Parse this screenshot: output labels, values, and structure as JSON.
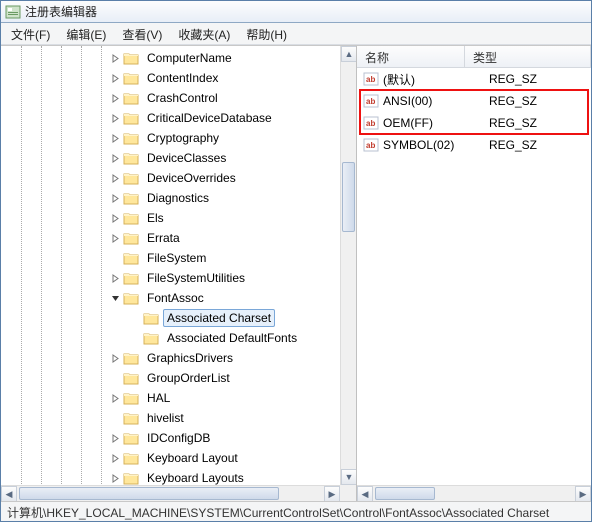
{
  "window": {
    "title": "注册表编辑器"
  },
  "menus": [
    {
      "label": "文件(F)"
    },
    {
      "label": "编辑(E)"
    },
    {
      "label": "查看(V)"
    },
    {
      "label": "收藏夹(A)"
    },
    {
      "label": "帮助(H)"
    }
  ],
  "tree": {
    "items": [
      {
        "label": "ComputerName",
        "depth": 0,
        "exp": "right"
      },
      {
        "label": "ContentIndex",
        "depth": 0,
        "exp": "right"
      },
      {
        "label": "CrashControl",
        "depth": 0,
        "exp": "right"
      },
      {
        "label": "CriticalDeviceDatabase",
        "depth": 0,
        "exp": "right"
      },
      {
        "label": "Cryptography",
        "depth": 0,
        "exp": "right"
      },
      {
        "label": "DeviceClasses",
        "depth": 0,
        "exp": "right"
      },
      {
        "label": "DeviceOverrides",
        "depth": 0,
        "exp": "right"
      },
      {
        "label": "Diagnostics",
        "depth": 0,
        "exp": "right"
      },
      {
        "label": "Els",
        "depth": 0,
        "exp": "right"
      },
      {
        "label": "Errata",
        "depth": 0,
        "exp": "right"
      },
      {
        "label": "FileSystem",
        "depth": 0,
        "exp": "none"
      },
      {
        "label": "FileSystemUtilities",
        "depth": 0,
        "exp": "right"
      },
      {
        "label": "FontAssoc",
        "depth": 0,
        "exp": "down"
      },
      {
        "label": "Associated Charset",
        "depth": 1,
        "exp": "none",
        "selected": true
      },
      {
        "label": "Associated DefaultFonts",
        "depth": 1,
        "exp": "none"
      },
      {
        "label": "GraphicsDrivers",
        "depth": 0,
        "exp": "right"
      },
      {
        "label": "GroupOrderList",
        "depth": 0,
        "exp": "none"
      },
      {
        "label": "HAL",
        "depth": 0,
        "exp": "right"
      },
      {
        "label": "hivelist",
        "depth": 0,
        "exp": "none"
      },
      {
        "label": "IDConfigDB",
        "depth": 0,
        "exp": "right"
      },
      {
        "label": "Keyboard Layout",
        "depth": 0,
        "exp": "right"
      },
      {
        "label": "Keyboard Layouts",
        "depth": 0,
        "exp": "right"
      }
    ]
  },
  "list": {
    "cols": {
      "name": "名称",
      "type": "类型"
    },
    "rows": [
      {
        "name": "(默认)",
        "type": "REG_SZ",
        "hl": false
      },
      {
        "name": "ANSI(00)",
        "type": "REG_SZ",
        "hl": true
      },
      {
        "name": "OEM(FF)",
        "type": "REG_SZ",
        "hl": true
      },
      {
        "name": "SYMBOL(02)",
        "type": "REG_SZ",
        "hl": false
      }
    ]
  },
  "status": {
    "path": "计算机\\HKEY_LOCAL_MACHINE\\SYSTEM\\CurrentControlSet\\Control\\FontAssoc\\Associated Charset"
  }
}
